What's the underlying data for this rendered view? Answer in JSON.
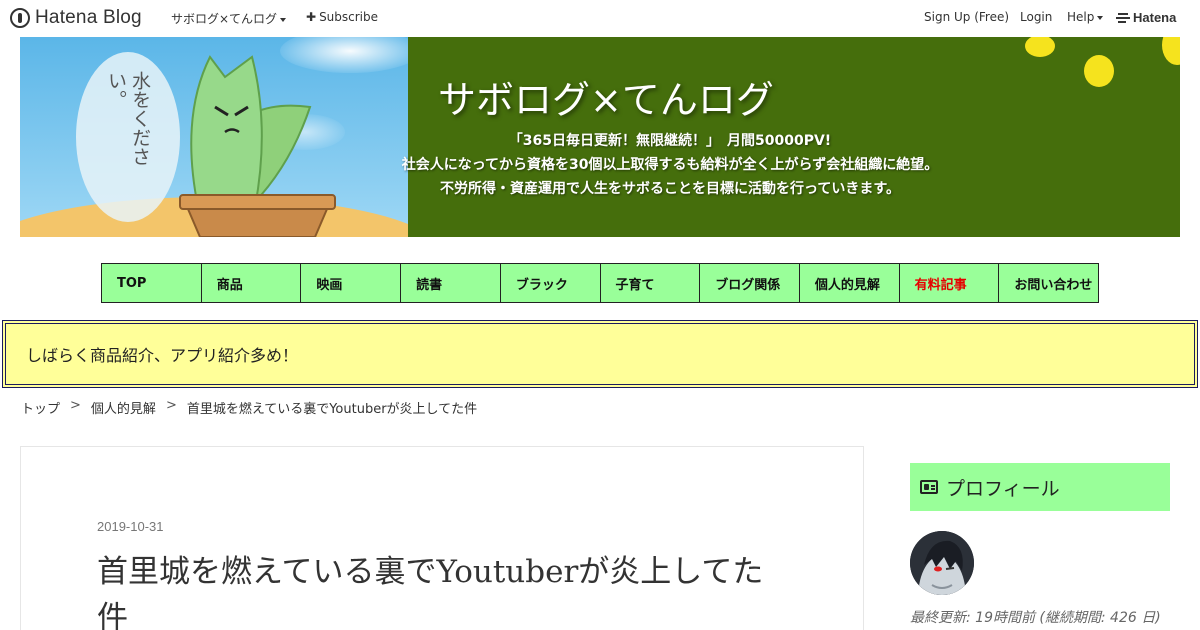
{
  "topbar": {
    "logo_text": "Hatena Blog",
    "blog_menu": "サボログ×てんログ",
    "subscribe": "Subscribe",
    "sign_up": "Sign Up (Free)",
    "login": "Login",
    "help": "Help",
    "hatena": "Hatena"
  },
  "banner": {
    "title": "サボログ×てんログ",
    "desc_line1": "「365日毎日更新！無限継続！」　月間50000PV!",
    "desc_line2": "社会人になってから資格を30個以上取得するも給料が全く上がらず会社組織に絶望。",
    "desc_line3": "不労所得・資産運用で人生をサボることを目標に活動を行っていきます。",
    "bubble_text": "水をください。"
  },
  "nav": [
    {
      "label": "TOP"
    },
    {
      "label": "商品"
    },
    {
      "label": "映画"
    },
    {
      "label": "読書"
    },
    {
      "label": "ブラック"
    },
    {
      "label": "子育て"
    },
    {
      "label": "ブログ関係"
    },
    {
      "label": "個人的見解"
    },
    {
      "label": "有料記事"
    },
    {
      "label": "お問い合わせ"
    }
  ],
  "notice": "しばらく商品紹介、アプリ紹介多め！",
  "breadcrumb": {
    "home": "トップ",
    "category": "個人的見解",
    "current": "首里城を燃えている裏でYoutuberが炎上してた件",
    "separator": ">"
  },
  "article": {
    "date": "2019-10-31",
    "title": "首里城を燃えている裏でYoutuberが炎上してた件"
  },
  "sidebar": {
    "profile_title": "プロフィール",
    "updated": "最終更新: 19時間前 (継続期間: 426 日)"
  },
  "colors": {
    "nav_bg": "#99ff99",
    "banner_bg": "#456e0c",
    "notice_bg": "#ffff99",
    "accent_red": "#e60000"
  }
}
